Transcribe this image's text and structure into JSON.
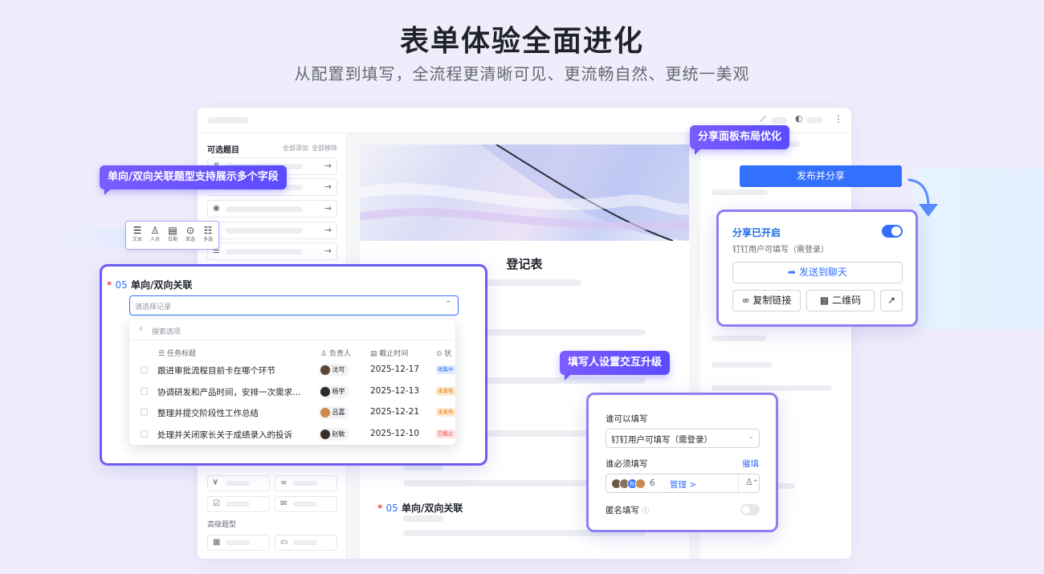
{
  "hero": {
    "title": "表单体验全面进化",
    "subtitle": "从配置到填写，全流程更清晰可见、更流畅自然、更统一美观"
  },
  "left_panel": {
    "title": "可选题目",
    "add_all": "全部添加",
    "remove_all": "全部移除",
    "advanced_title": "高级题型"
  },
  "callouts": {
    "association": "单向/双向关联题型支持展示多个字段",
    "share_panel": "分享面板布局优化",
    "filler": "填写人设置交互升级"
  },
  "toolbar": {
    "items": [
      {
        "label": "文本",
        "icon": "lines-icon"
      },
      {
        "label": "人员",
        "icon": "person-icon"
      },
      {
        "label": "日期",
        "icon": "calendar-icon"
      },
      {
        "label": "单选",
        "icon": "check-circle-icon"
      },
      {
        "label": "多选",
        "icon": "list-icon"
      }
    ]
  },
  "form": {
    "title": "登记表",
    "question": {
      "required_mark": "*",
      "number": "05",
      "title": "单向/双向关联"
    }
  },
  "association": {
    "required_mark": "*",
    "number": "05",
    "title": "单向/双向关联",
    "placeholder": "请选择记录",
    "search_placeholder": "搜索选项",
    "columns": {
      "task": "任务标题",
      "owner": "负责人",
      "deadline": "截止时间",
      "status": "状"
    },
    "rows": [
      {
        "title": "跟进审批流程目前卡在哪个环节",
        "owner": "沈可",
        "date": "2025-12-17",
        "status": "收集中"
      },
      {
        "title": "协调研发和产品时间，安排一次需求…",
        "owner": "杨宇",
        "date": "2025-12-13",
        "status": "未发布"
      },
      {
        "title": "整理并提交阶段性工作总结",
        "owner": "吕嘉",
        "date": "2025-12-21",
        "status": "未发布"
      },
      {
        "title": "处理并关闭家长关于成绩录入的投诉",
        "owner": "赵敏",
        "date": "2025-12-10",
        "status": "已截止"
      }
    ]
  },
  "share": {
    "publish_button": "发布并分享",
    "status_title": "分享已开启",
    "scope": "钉钉用户可填写（需登录）",
    "send_chat": "发送到聊天",
    "copy_link": "复制链接",
    "qr_code": "二维码",
    "enabled": true
  },
  "filler": {
    "who_can_fill_label": "谁可以填写",
    "who_can_fill_value": "钉钉用户可填写（需登录）",
    "must_fill_label": "谁必须填写",
    "remind_link": "催填",
    "member_count": "6",
    "manage_link": "管理 >",
    "avatar_text": "秋",
    "anonymous_label": "匿名填写",
    "anonymous_enabled": false
  },
  "colors": {
    "brand_blue": "#3370ff",
    "callout_purple": "#6e55ff",
    "card_border": "#8e7ff0",
    "status_collecting": "#3370ff",
    "status_unpublished": "#de7802",
    "status_closed": "#f54a45"
  }
}
